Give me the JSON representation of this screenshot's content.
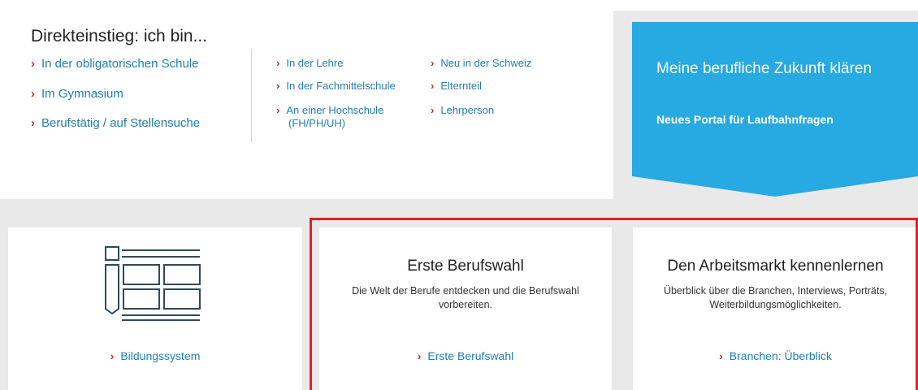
{
  "direkteinstieg": {
    "title": "Direkteinstieg: ich bin...",
    "col1": [
      "In der obligatorischen Schule",
      "Im Gymnasium",
      "Berufstätig / auf Stellensuche"
    ],
    "col2": [
      "In der Lehre",
      "In der Fachmittelschule",
      "An einer Hochschule",
      "(FH/PH/UH)"
    ],
    "col3": [
      "Neu in der Schweiz",
      "Elternteil",
      "Lehrperson"
    ]
  },
  "banner": {
    "title": "Meine berufliche Zukunft klären",
    "subtitle": "Neues Portal für Laufbahnfragen",
    "color": "#27a9e1"
  },
  "cards": [
    {
      "title": "",
      "desc1": "",
      "desc2": "",
      "link": "Bildungssystem",
      "icon": "education-system-icon"
    },
    {
      "title": "Erste Berufswahl",
      "desc1": "Die Welt der Berufe entdecken und die Berufswahl",
      "desc2": "vorbereiten.",
      "link": "Erste Berufswahl"
    },
    {
      "title": "Den Arbeitsmarkt kennenlernen",
      "desc1": "Überblick über die Branchen, Interviews, Porträts,",
      "desc2": "Weiterbildungsmöglichkeiten.",
      "link": "Branchen: Überblick"
    }
  ],
  "colors": {
    "link": "#1f7fb5",
    "chevron": "#d2262b",
    "highlight": "#e32025"
  }
}
